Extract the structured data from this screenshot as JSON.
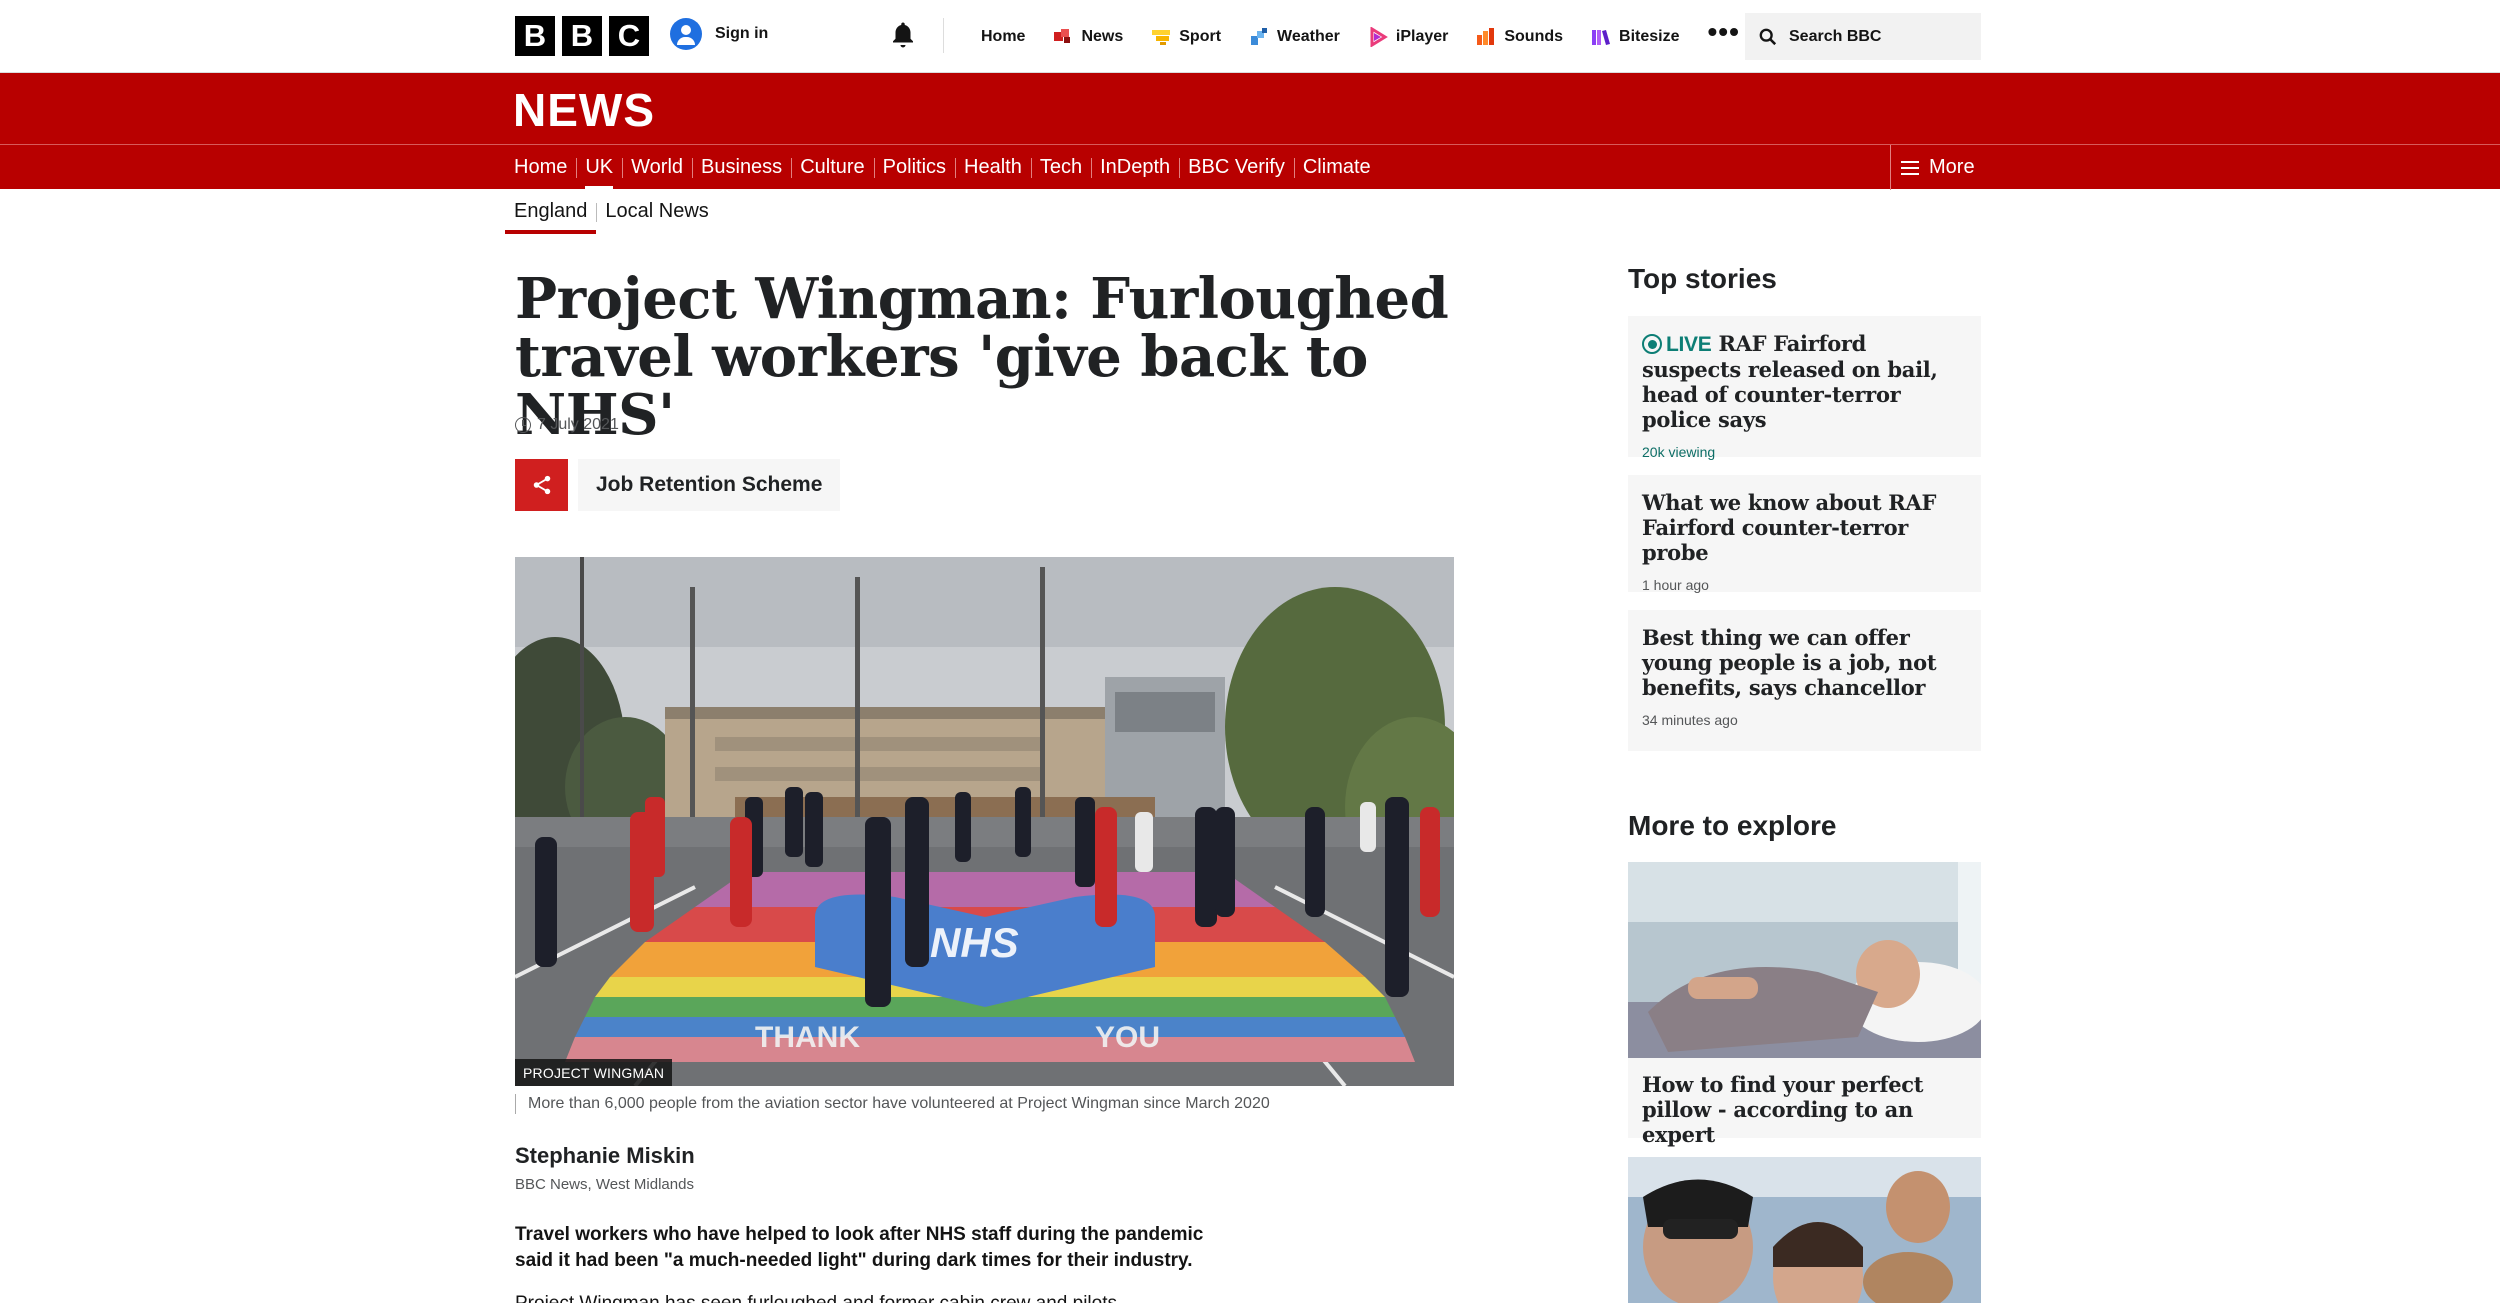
{
  "masthead": {
    "logo_letters": [
      "B",
      "B",
      "C"
    ],
    "sign_in": "Sign in",
    "nav": [
      {
        "label": "Home",
        "icon": "none"
      },
      {
        "label": "News",
        "icon": "news-icon",
        "color": "#d01f1f"
      },
      {
        "label": "Sport",
        "icon": "sport-icon",
        "color": "#ffd230"
      },
      {
        "label": "Weather",
        "icon": "weather-icon",
        "color": "#3b8bd9"
      },
      {
        "label": "iPlayer",
        "icon": "iplayer-icon",
        "color": "#ea3b7b"
      },
      {
        "label": "Sounds",
        "icon": "sounds-icon",
        "color": "#f55a1a"
      },
      {
        "label": "Bitesize",
        "icon": "bitesize-icon",
        "color": "#8a3ff5"
      }
    ],
    "more_dots": "•••",
    "search_label": "Search BBC"
  },
  "banner": {
    "brand": "NEWS",
    "color": "#b80000"
  },
  "subnav": {
    "links": [
      "Home",
      "UK",
      "World",
      "Business",
      "Culture",
      "Politics",
      "Health",
      "Tech",
      "InDepth",
      "BBC Verify",
      "Climate"
    ],
    "active": "UK",
    "more_label": "More"
  },
  "secnav": {
    "links": [
      "England",
      "Local News"
    ],
    "active": "England"
  },
  "article": {
    "headline": "Project Wingman: Furloughed travel workers 'give back to NHS'",
    "date": "7 July 2021",
    "topic": "Job Retention Scheme",
    "image_label": "PROJECT WINGMAN",
    "caption": "More than 6,000 people from the aviation sector have volunteered at Project Wingman since March 2020",
    "author": "Stephanie Miskin",
    "author_role": "BBC News, West Midlands",
    "lede": "Travel workers who have helped to look after NHS staff during the pandemic said it had been \"a much-needed light\" during dark times for their industry.",
    "paragraph": "Project Wingman has seen furloughed and former cabin crew and pilots"
  },
  "sidebar": {
    "top_stories_heading": "Top stories",
    "top_stories": [
      {
        "live": "LIVE",
        "title": "RAF Fairford suspects released on bail, head of counter-terror police says",
        "meta": "20k viewing"
      },
      {
        "live": "",
        "title": "What we know about RAF Fairford counter-terror probe",
        "meta": "1 hour ago"
      },
      {
        "live": "",
        "title": "Best thing we can offer young people is a job, not benefits, says chancellor",
        "meta": "34 minutes ago"
      }
    ],
    "explore_heading": "More to explore",
    "explore": [
      {
        "title": "How to find your perfect pillow - according to an expert"
      },
      {
        "title": ""
      }
    ]
  }
}
